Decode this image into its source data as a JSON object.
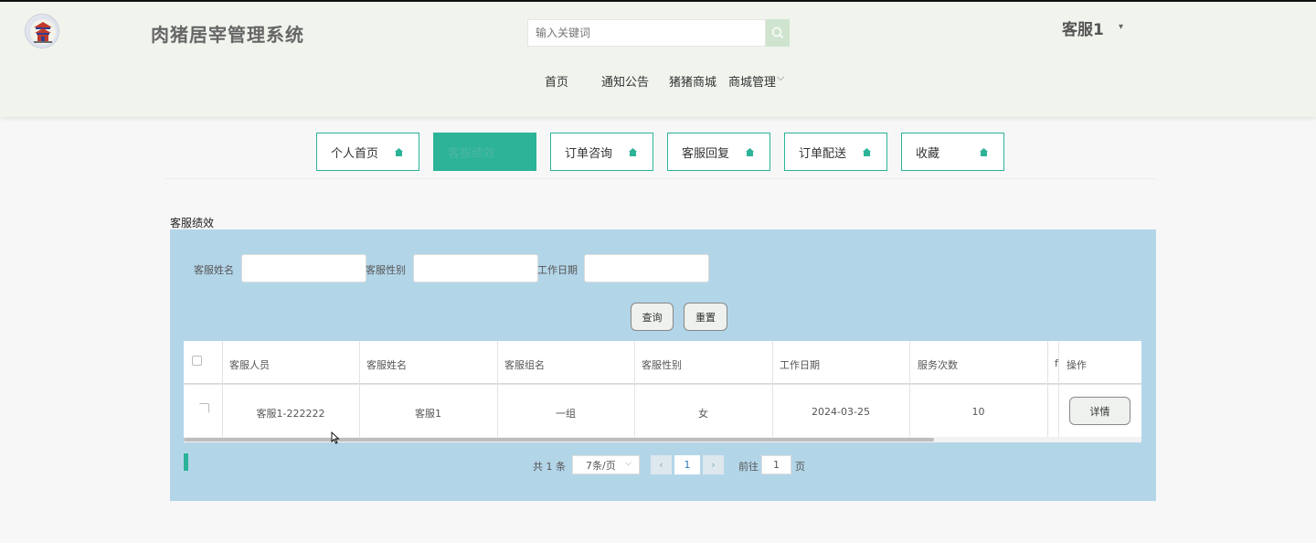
{
  "header": {
    "site_title": "肉猪居宰管理系统",
    "search_placeholder": "输入关键词",
    "user_name": "客服1",
    "user_caret": "▾"
  },
  "nav": {
    "items": [
      {
        "label": "首页"
      },
      {
        "label": "通知公告"
      },
      {
        "label": "猪猪商城"
      },
      {
        "label": "商城管理"
      }
    ],
    "dropdown_caret": "⌵"
  },
  "tabs": [
    {
      "label": "个人首页",
      "active": false
    },
    {
      "label": "客服绩效",
      "active": true
    },
    {
      "label": "订单咨询",
      "active": false
    },
    {
      "label": "客服回复",
      "active": false
    },
    {
      "label": "订单配送",
      "active": false
    },
    {
      "label": "收藏",
      "active": false
    }
  ],
  "section_title": "客服绩效",
  "filters": [
    {
      "label": "客服姓名",
      "value": ""
    },
    {
      "label": "客服性别",
      "value": ""
    },
    {
      "label": "工作日期",
      "value": ""
    }
  ],
  "buttons": {
    "query": "查询",
    "reset": "重置"
  },
  "table": {
    "columns": [
      "客服人员",
      "客服姓名",
      "客服组名",
      "客服性别",
      "工作日期",
      "服务次数",
      "f",
      "操作"
    ],
    "rows": [
      {
        "cells": [
          "客服1-222222",
          "客服1",
          "一组",
          "女",
          "2024-03-25",
          "10"
        ],
        "action": "详情"
      }
    ]
  },
  "pagination": {
    "total_text": "共 1 条",
    "page_size": "7条/页",
    "current_page": "1",
    "prev": "‹",
    "next": "›",
    "goto_prefix": "前往",
    "goto_value": "1",
    "goto_suffix": "页"
  },
  "colors": {
    "accent": "#2cb398",
    "panel_bg": "#b3d5e8",
    "header_bg": "#f0f4ed"
  }
}
